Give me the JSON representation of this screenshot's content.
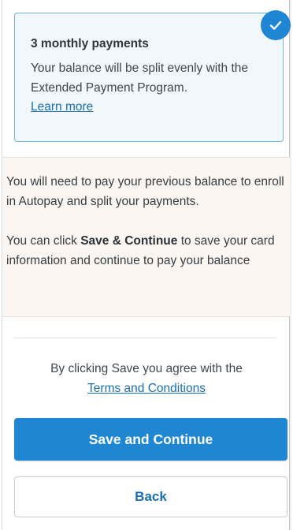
{
  "plan_option": {
    "title": "3 monthly payments",
    "description": "Your balance will be split evenly with the Extended Payment Program.",
    "learn_more": "Learn more",
    "selected": true,
    "icon": "check-icon"
  },
  "notice": {
    "line1": "You will need to pay your previous balance to enroll in Autopay and split your payments.",
    "line2_prefix": "You can click ",
    "line2_bold": "Save & Continue",
    "line2_suffix": " to save your card information and continue to pay your balance"
  },
  "agreement": {
    "text": "By clicking Save you agree with the",
    "link": "Terms and Conditions"
  },
  "buttons": {
    "primary": "Save and Continue",
    "secondary": "Back"
  },
  "colors": {
    "accent": "#1f86d4",
    "link": "#1a6fae",
    "card_background": "#f1f7fb",
    "notice_background": "#fbf6f1"
  }
}
